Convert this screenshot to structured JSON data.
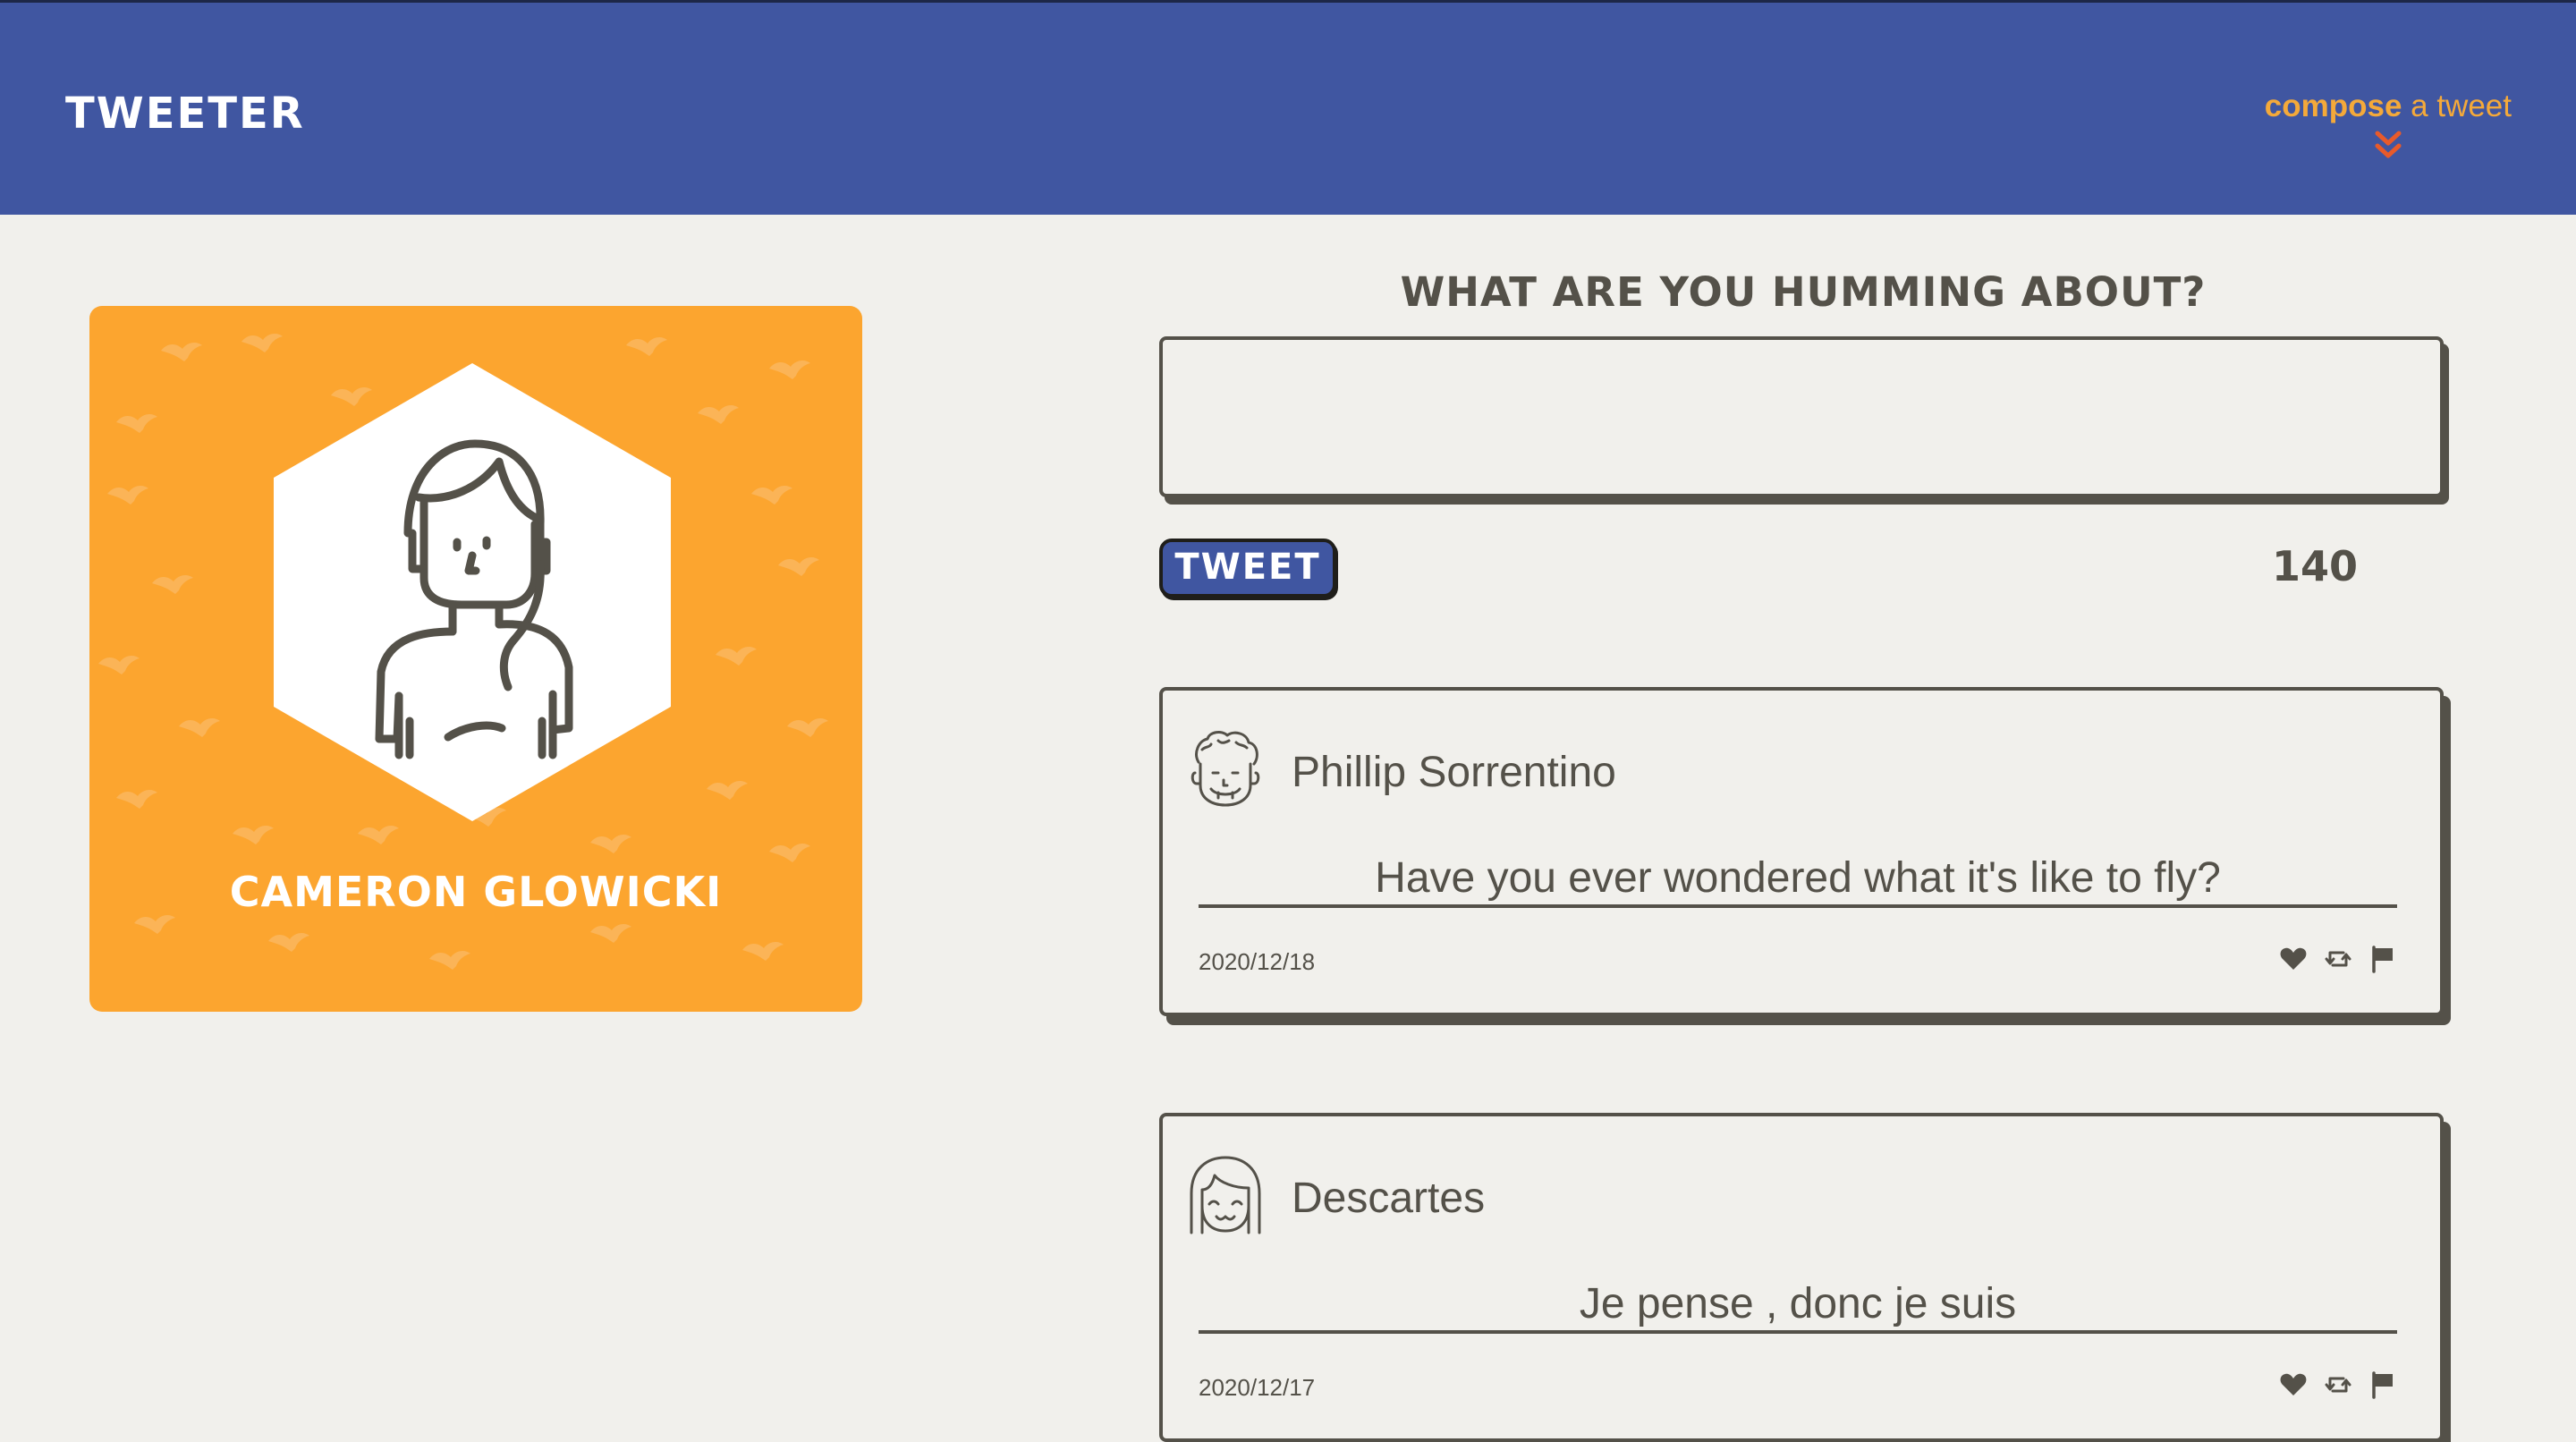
{
  "nav": {
    "brand": "Tweeter",
    "compose_strong": "compose",
    "compose_rest": " a tweet",
    "compose_icon": "double-chevron-down-icon",
    "accent_color": "#f4a93a",
    "chevron_color": "#e85a2a",
    "background": "#4056a1"
  },
  "profile": {
    "name": "Cameron Glowicki",
    "avatar_icon": "woman-avatar-icon",
    "background": "#fca52f"
  },
  "composer": {
    "prompt": "What are you humming about?",
    "input_value": "",
    "button_label": "Tweet",
    "counter": "140"
  },
  "tweets": [
    {
      "author": "Phillip Sorrentino",
      "avatar_icon": "curly-man-avatar-icon",
      "content": "Have you ever wondered what it's like to fly?",
      "date": "2020/12/18",
      "actions": [
        "heart-icon",
        "retweet-icon",
        "flag-icon"
      ]
    },
    {
      "author": "Descartes",
      "avatar_icon": "bob-hair-avatar-icon",
      "content": "Je pense , donc je suis",
      "date": "2020/12/17",
      "actions": [
        "heart-icon",
        "retweet-icon",
        "flag-icon"
      ]
    }
  ],
  "colors": {
    "page_bg": "#f1f0ec",
    "text": "#545149"
  }
}
